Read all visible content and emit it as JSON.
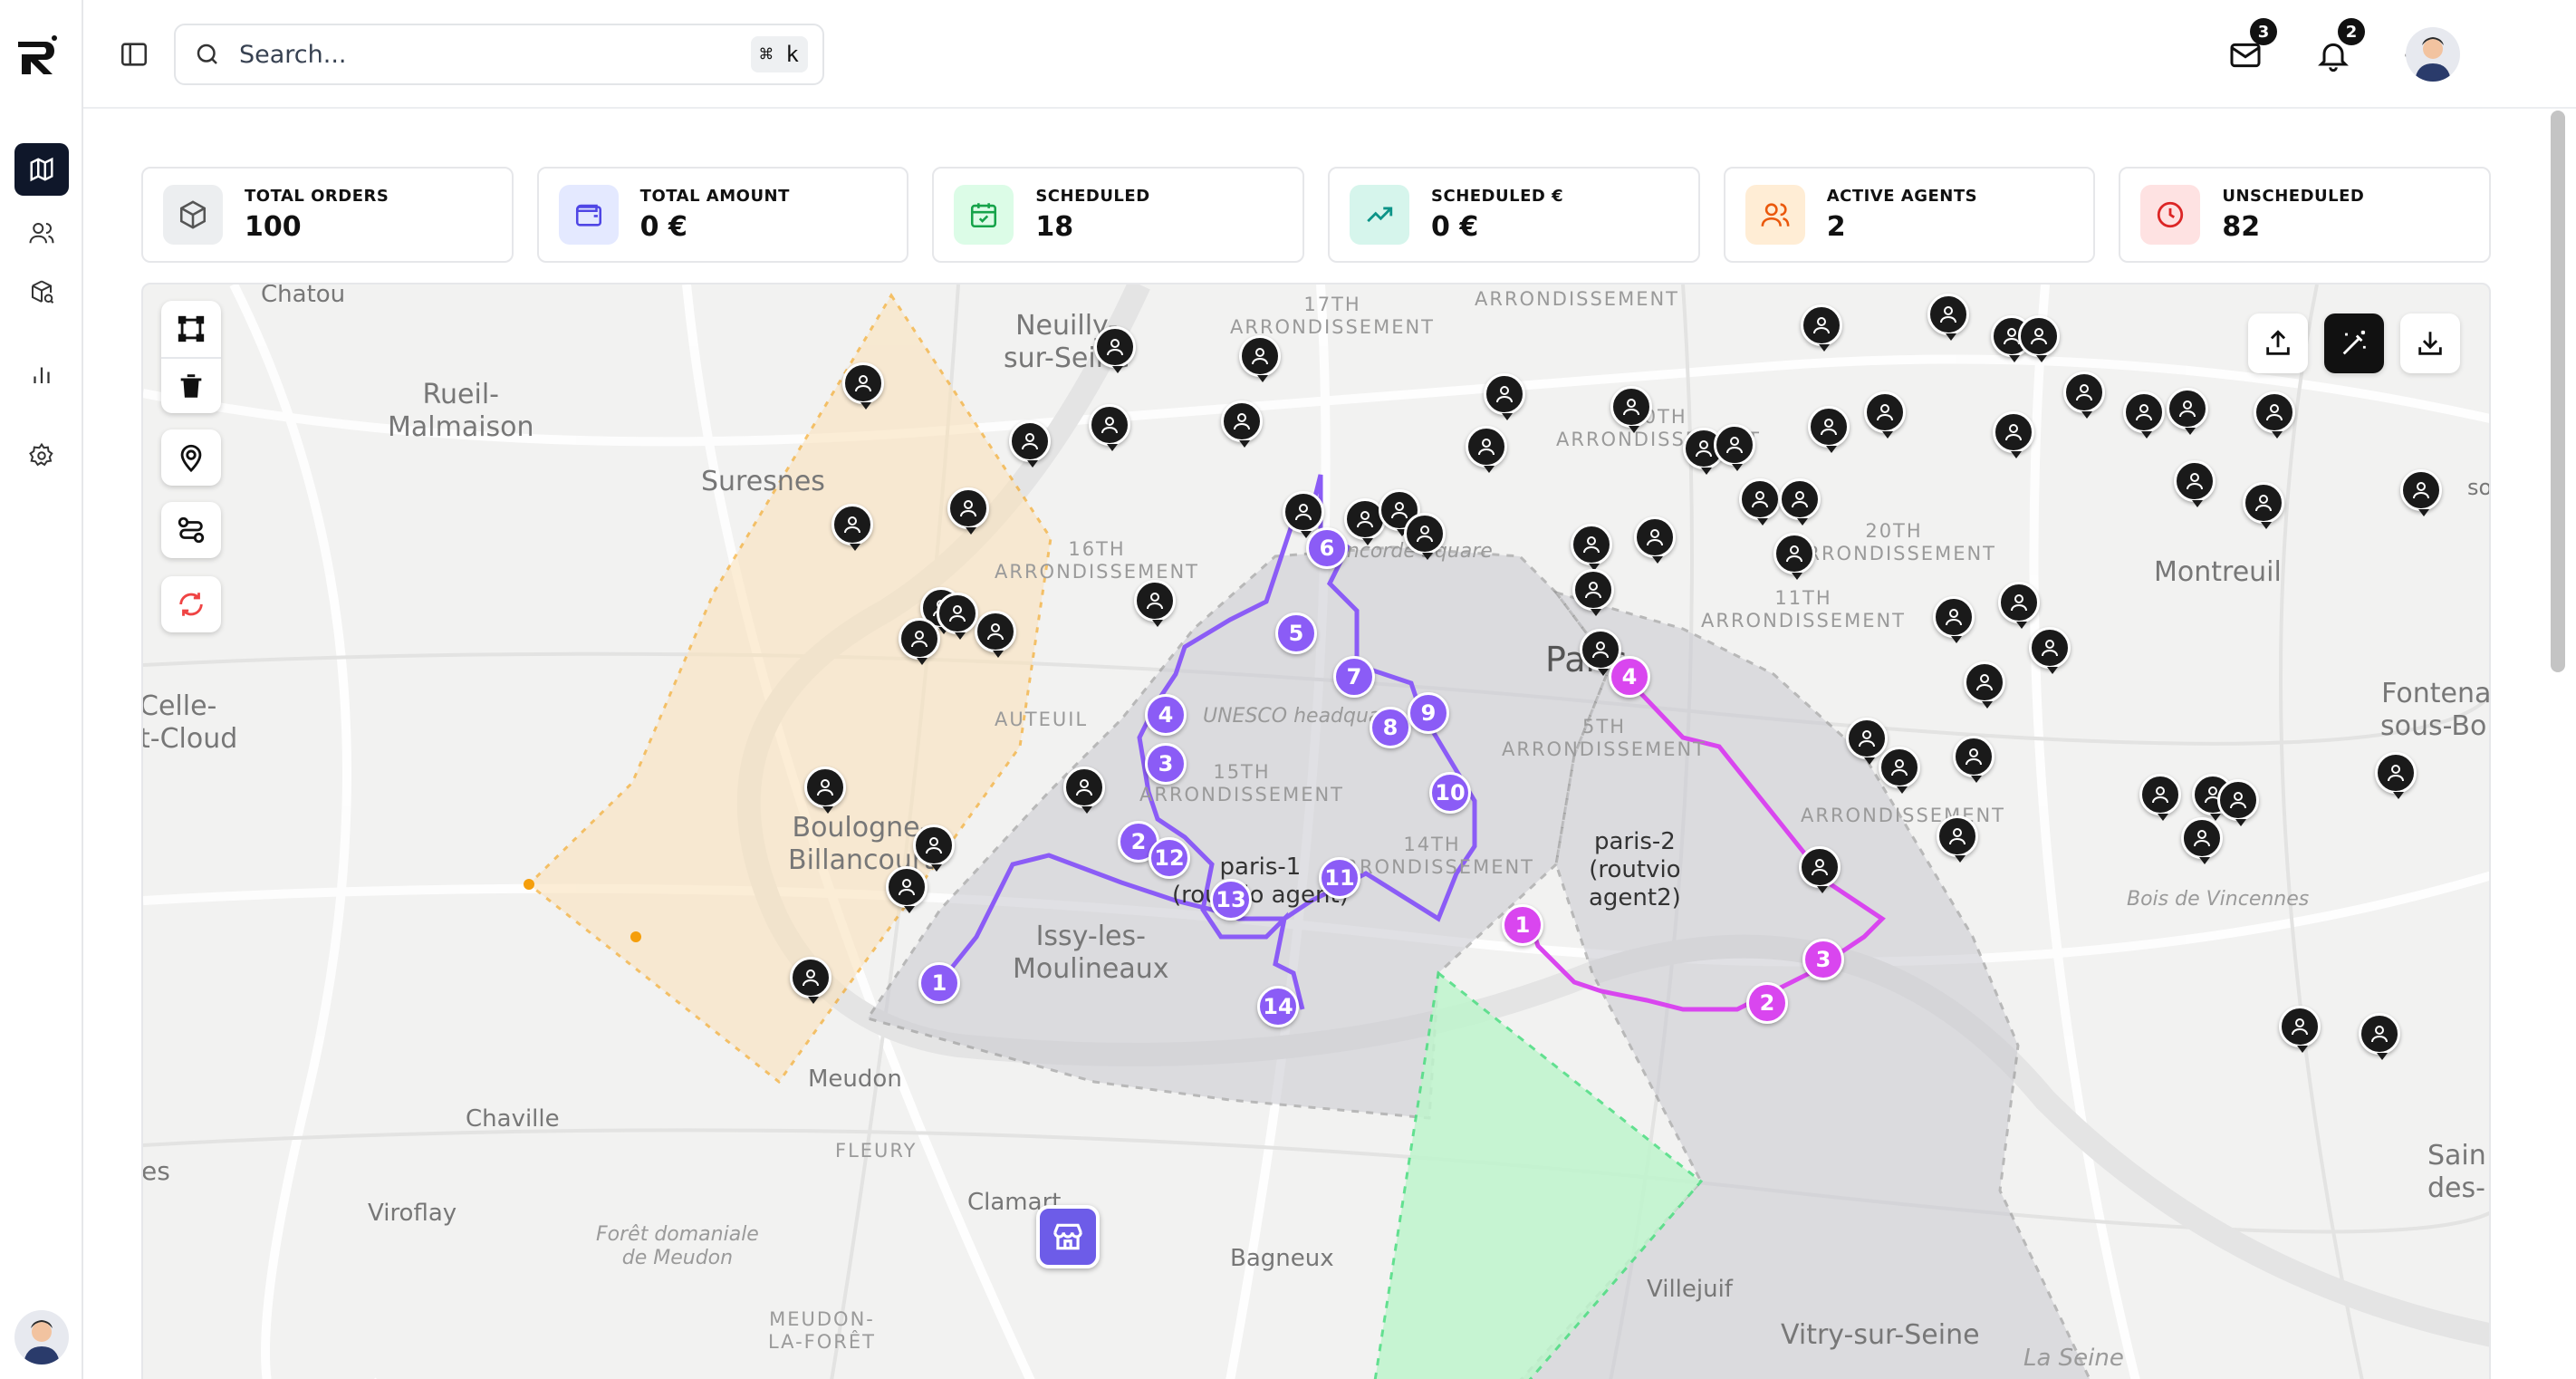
{
  "search": {
    "placeholder": "Search...",
    "shortcut": "⌘ k"
  },
  "header": {
    "mail_badge": "3",
    "notif_badge": "2"
  },
  "stats": [
    {
      "label": "TOTAL ORDERS",
      "value": "100",
      "icon": "package-icon",
      "color": "#e5e7eb"
    },
    {
      "label": "TOTAL AMOUNT",
      "value": "0 €",
      "icon": "wallet-icon",
      "color": "#e0e7ff"
    },
    {
      "label": "SCHEDULED",
      "value": "18",
      "icon": "calendar-check-icon",
      "color": "#dcfce7"
    },
    {
      "label": "SCHEDULED €",
      "value": "0 €",
      "icon": "trending-up-icon",
      "color": "#d1fae5"
    },
    {
      "label": "ACTIVE AGENTS",
      "value": "2",
      "icon": "users-icon",
      "color": "#ffedd5"
    },
    {
      "label": "UNSCHEDULED",
      "value": "82",
      "icon": "clock-icon",
      "color": "#fee2e2"
    }
  ],
  "map": {
    "places": {
      "chatou": "Chatou",
      "neuilly": "Neuilly-\nsur-Seine",
      "arr17": "17TH\nARRONDISSEMENT",
      "arr_top": "ARRONDISSEMENT",
      "rueil": "Rueil-\nMalmaison",
      "suresnes": "Suresnes",
      "arr10": "10TH\nARRONDISSEMENT",
      "arr20": "20TH\nARRONDISSEMENT",
      "montreuil": "Montreuil",
      "arr16": "16TH\nARRONDISSEMENT",
      "concorde": "Concorde Square",
      "arr11": "11TH\nARRONDISSEMENT",
      "paris": "Paris",
      "auteuil": "AUTEUIL",
      "unesco": "UNESCO headquar...",
      "arr15": "15TH\nARRONDISSEMENT",
      "arr5": "5TH\nARRONDISSEMENT",
      "celle": "Celle-\nt-Cloud",
      "fontenay": "Fontenay\nsous-Bois",
      "arr12": "ARRONDISSEMENT",
      "boulogne": "Boulogne-\nBillancourt",
      "arr14": "14TH\nARRONDISSEMENT",
      "zone1": "paris-1\n(routvio agent)",
      "zone2": "paris-2\n(routvio\nagent2)",
      "vincennes": "Bois de Vincennes",
      "issy": "Issy-les-\nMoulineaux",
      "meudon": "Meudon",
      "chaville": "Chaville",
      "fleury": "FLEURY",
      "clamart": "Clamart",
      "viroflay": "Viroflay",
      "foret": "Forêt domaniale\nde Meudon",
      "bagneux": "Bagneux",
      "villejuif": "Villejuif",
      "vitry": "Vitry-sur-Seine",
      "laseine": "La Seine",
      "meudonforet": "MEUDON-\nLA-FORÊT",
      "es": "es",
      "sain": "Sain\ndes-",
      "so": "so"
    }
  }
}
